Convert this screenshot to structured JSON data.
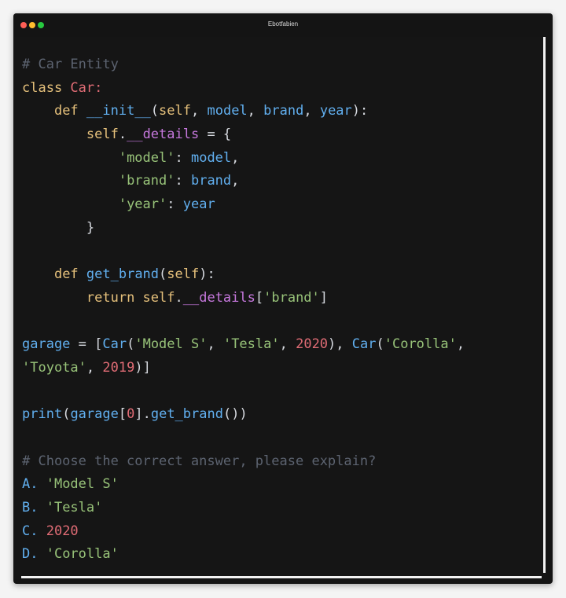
{
  "window": {
    "title": "Ebotfabien",
    "controls": [
      {
        "name": "close",
        "color": "#ff5f56"
      },
      {
        "name": "minimize",
        "color": "#ffbd2e"
      },
      {
        "name": "maximize",
        "color": "#27c93f"
      }
    ]
  },
  "theme": {
    "comment": "#5c6370",
    "keyword": "#e5c07b",
    "class_name": "#e06c75",
    "function": "#61afef",
    "string": "#98c379",
    "number": "#e06c75",
    "identifier": "#61afef",
    "self": "#e5c07b",
    "private_attr": "#c678dd",
    "punct": "#d7dae0"
  },
  "code_lines": [
    [
      {
        "t": "# Car Entity",
        "k": "comment"
      }
    ],
    [
      {
        "t": "class ",
        "k": "keyword"
      },
      {
        "t": "Car",
        "k": "class_name"
      },
      {
        "t": ":",
        "k": "class_name"
      }
    ],
    [
      {
        "t": "    ",
        "k": "punct"
      },
      {
        "t": "def ",
        "k": "keyword"
      },
      {
        "t": "__init__",
        "k": "function"
      },
      {
        "t": "(",
        "k": "punct"
      },
      {
        "t": "self",
        "k": "self"
      },
      {
        "t": ", ",
        "k": "punct"
      },
      {
        "t": "model",
        "k": "identifier"
      },
      {
        "t": ", ",
        "k": "punct"
      },
      {
        "t": "brand",
        "k": "identifier"
      },
      {
        "t": ", ",
        "k": "punct"
      },
      {
        "t": "year",
        "k": "identifier"
      },
      {
        "t": "):",
        "k": "punct"
      }
    ],
    [
      {
        "t": "        ",
        "k": "punct"
      },
      {
        "t": "self",
        "k": "self"
      },
      {
        "t": ".",
        "k": "punct"
      },
      {
        "t": "__details",
        "k": "private_attr"
      },
      {
        "t": " = {",
        "k": "punct"
      }
    ],
    [
      {
        "t": "            ",
        "k": "punct"
      },
      {
        "t": "'model'",
        "k": "string"
      },
      {
        "t": ": ",
        "k": "punct"
      },
      {
        "t": "model",
        "k": "identifier"
      },
      {
        "t": ",",
        "k": "punct"
      }
    ],
    [
      {
        "t": "            ",
        "k": "punct"
      },
      {
        "t": "'brand'",
        "k": "string"
      },
      {
        "t": ": ",
        "k": "punct"
      },
      {
        "t": "brand",
        "k": "identifier"
      },
      {
        "t": ",",
        "k": "punct"
      }
    ],
    [
      {
        "t": "            ",
        "k": "punct"
      },
      {
        "t": "'year'",
        "k": "string"
      },
      {
        "t": ": ",
        "k": "punct"
      },
      {
        "t": "year",
        "k": "identifier"
      }
    ],
    [
      {
        "t": "        }",
        "k": "punct"
      }
    ],
    [
      {
        "t": "",
        "k": "punct"
      }
    ],
    [
      {
        "t": "    ",
        "k": "punct"
      },
      {
        "t": "def ",
        "k": "keyword"
      },
      {
        "t": "get_brand",
        "k": "function"
      },
      {
        "t": "(",
        "k": "punct"
      },
      {
        "t": "self",
        "k": "self"
      },
      {
        "t": "):",
        "k": "punct"
      }
    ],
    [
      {
        "t": "        ",
        "k": "punct"
      },
      {
        "t": "return ",
        "k": "keyword"
      },
      {
        "t": "self",
        "k": "self"
      },
      {
        "t": ".",
        "k": "punct"
      },
      {
        "t": "__details",
        "k": "private_attr"
      },
      {
        "t": "[",
        "k": "punct"
      },
      {
        "t": "'brand'",
        "k": "string"
      },
      {
        "t": "]",
        "k": "punct"
      }
    ],
    [
      {
        "t": "",
        "k": "punct"
      }
    ],
    [
      {
        "t": "garage",
        "k": "identifier"
      },
      {
        "t": " = [",
        "k": "punct"
      },
      {
        "t": "Car",
        "k": "identifier"
      },
      {
        "t": "(",
        "k": "punct"
      },
      {
        "t": "'Model S'",
        "k": "string"
      },
      {
        "t": ", ",
        "k": "punct"
      },
      {
        "t": "'Tesla'",
        "k": "string"
      },
      {
        "t": ", ",
        "k": "punct"
      },
      {
        "t": "2020",
        "k": "number"
      },
      {
        "t": "), ",
        "k": "punct"
      },
      {
        "t": "Car",
        "k": "identifier"
      },
      {
        "t": "(",
        "k": "punct"
      },
      {
        "t": "'Corolla'",
        "k": "string"
      },
      {
        "t": ",",
        "k": "punct"
      }
    ],
    [
      {
        "t": "'Toyota'",
        "k": "string"
      },
      {
        "t": ", ",
        "k": "punct"
      },
      {
        "t": "2019",
        "k": "number"
      },
      {
        "t": ")]",
        "k": "punct"
      }
    ],
    [
      {
        "t": "",
        "k": "punct"
      }
    ],
    [
      {
        "t": "print",
        "k": "function"
      },
      {
        "t": "(",
        "k": "punct"
      },
      {
        "t": "garage",
        "k": "identifier"
      },
      {
        "t": "[",
        "k": "punct"
      },
      {
        "t": "0",
        "k": "number"
      },
      {
        "t": "].",
        "k": "punct"
      },
      {
        "t": "get_brand",
        "k": "function"
      },
      {
        "t": "())",
        "k": "punct"
      }
    ],
    [
      {
        "t": "",
        "k": "punct"
      }
    ],
    [
      {
        "t": "# Choose the correct answer, please explain?",
        "k": "comment"
      }
    ],
    [
      {
        "t": "A. ",
        "k": "identifier"
      },
      {
        "t": "'Model S'",
        "k": "string"
      }
    ],
    [
      {
        "t": "B. ",
        "k": "identifier"
      },
      {
        "t": "'Tesla'",
        "k": "string"
      }
    ],
    [
      {
        "t": "C. ",
        "k": "identifier"
      },
      {
        "t": "2020",
        "k": "number"
      }
    ],
    [
      {
        "t": "D. ",
        "k": "identifier"
      },
      {
        "t": "'Corolla'",
        "k": "string"
      }
    ]
  ]
}
